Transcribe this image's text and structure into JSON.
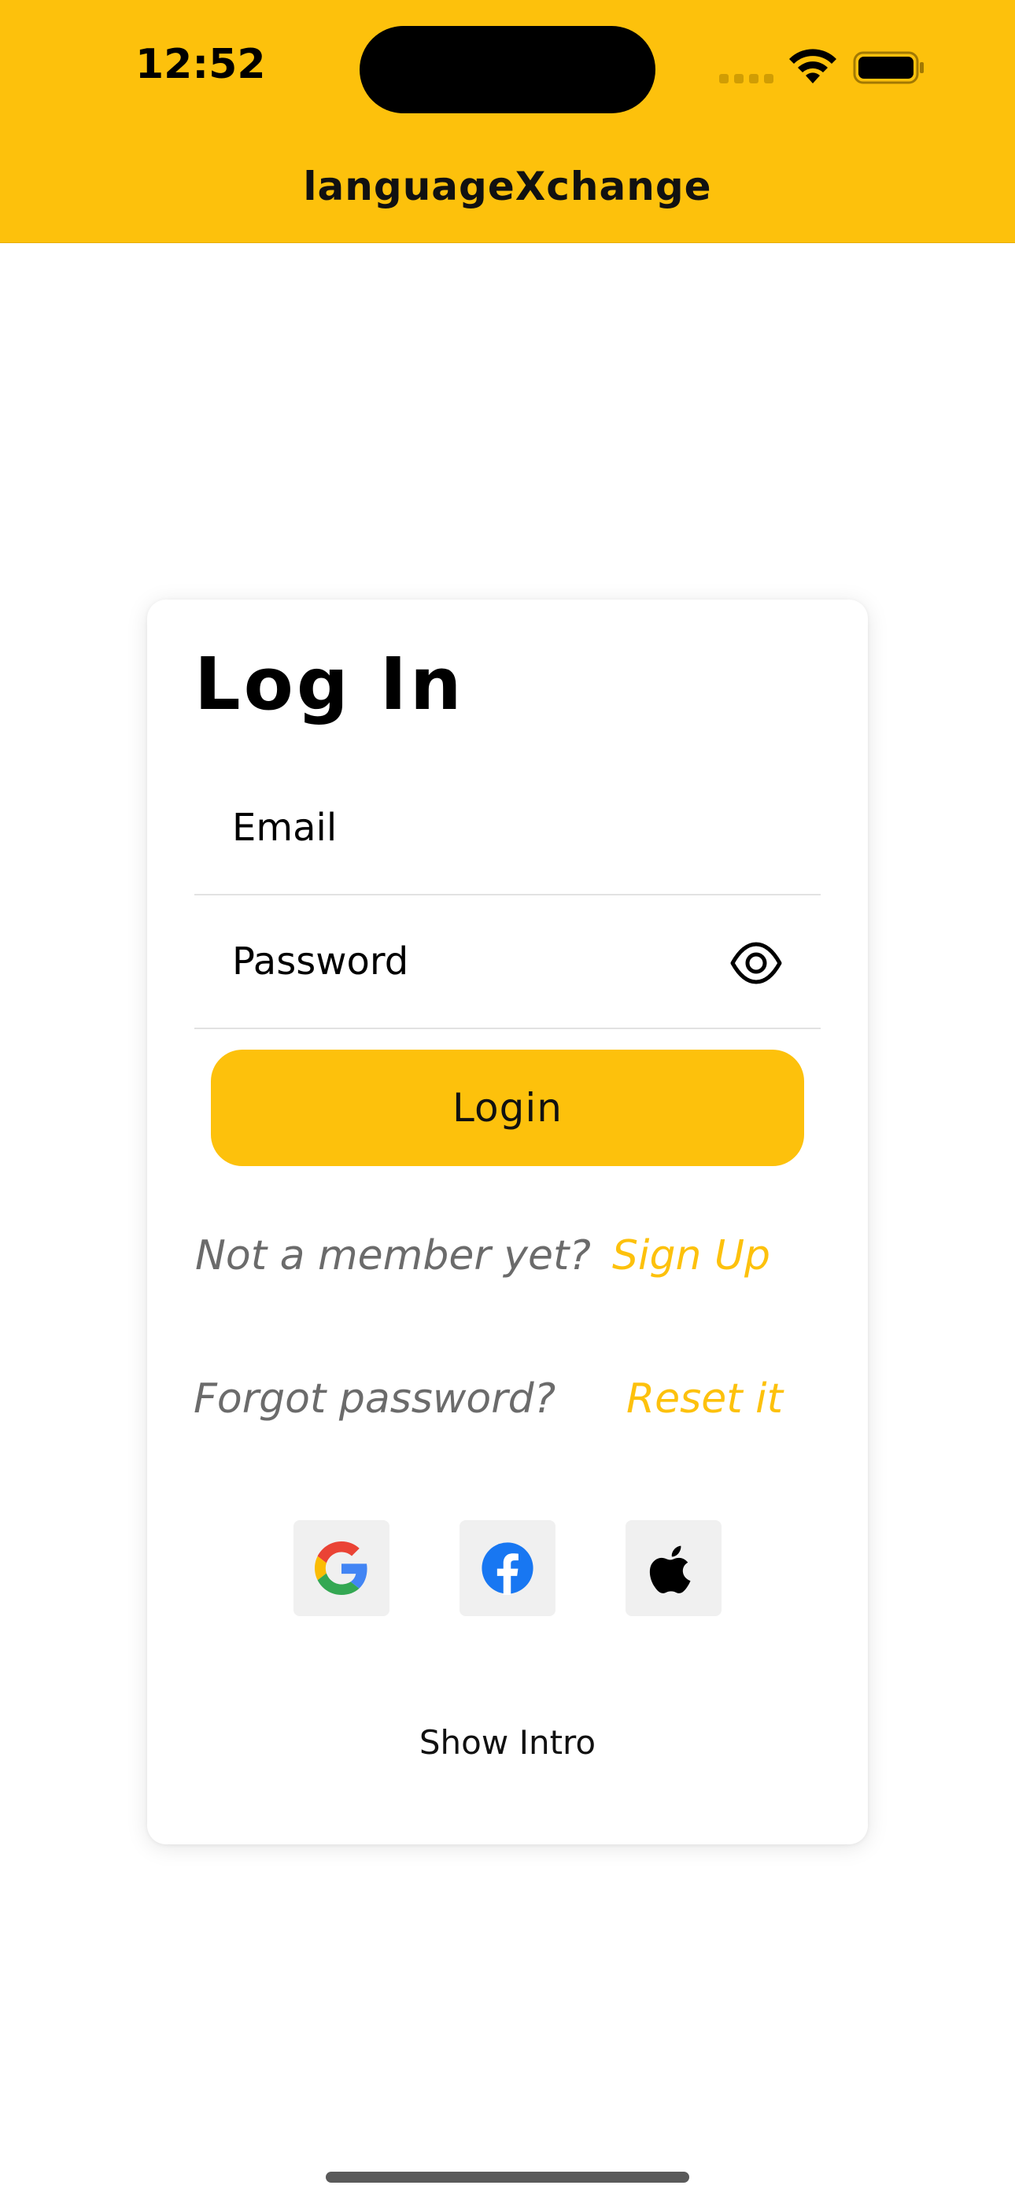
{
  "status_bar": {
    "time": "12:52"
  },
  "header": {
    "title": "languageXchange"
  },
  "login_card": {
    "title": "Log In",
    "email_placeholder": "Email",
    "password_placeholder": "Password",
    "login_button_label": "Login",
    "signup_prompt": "Not a member yet?",
    "signup_link": "Sign Up",
    "forgot_prompt": "Forgot password?",
    "reset_link": "Reset it",
    "social_icons": [
      "google-icon",
      "facebook-icon",
      "apple-icon"
    ],
    "show_intro_label": "Show Intro"
  },
  "colors": {
    "brand_yellow": "#FDC10C",
    "muted_text": "#6b6b6b",
    "facebook_blue": "#1877F2"
  }
}
